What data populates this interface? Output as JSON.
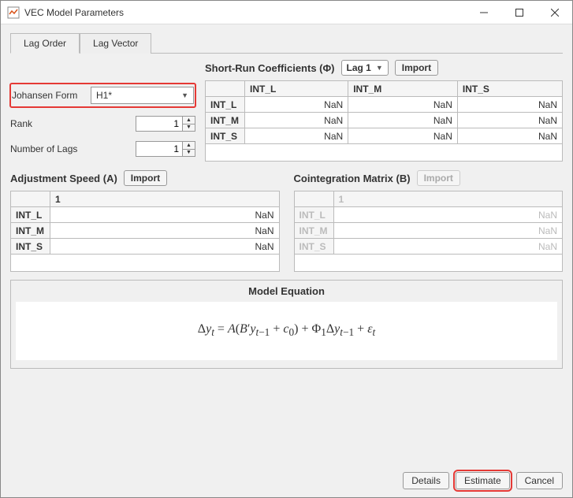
{
  "window": {
    "title": "VEC Model Parameters"
  },
  "tabs": {
    "lag_order": "Lag Order",
    "lag_vector": "Lag Vector"
  },
  "params": {
    "johansen_label": "Johansen Form",
    "johansen_value": "H1*",
    "rank_label": "Rank",
    "rank_value": "1",
    "numlags_label": "Number of Lags",
    "numlags_value": "1"
  },
  "short_run": {
    "title": "Short-Run Coefficients (Φ)",
    "lag_dropdown": "Lag 1",
    "import_label": "Import",
    "cols": [
      "INT_L",
      "INT_M",
      "INT_S"
    ],
    "rows": [
      {
        "name": "INT_L",
        "vals": [
          "NaN",
          "NaN",
          "NaN"
        ]
      },
      {
        "name": "INT_M",
        "vals": [
          "NaN",
          "NaN",
          "NaN"
        ]
      },
      {
        "name": "INT_S",
        "vals": [
          "NaN",
          "NaN",
          "NaN"
        ]
      }
    ]
  },
  "adj_speed": {
    "title": "Adjustment Speed (A)",
    "import_label": "Import",
    "col": "1",
    "rows": [
      {
        "name": "INT_L",
        "val": "NaN"
      },
      {
        "name": "INT_M",
        "val": "NaN"
      },
      {
        "name": "INT_S",
        "val": "NaN"
      }
    ]
  },
  "coint_matrix": {
    "title": "Cointegration Matrix (B)",
    "import_label": "Import",
    "col": "1",
    "rows": [
      {
        "name": "INT_L",
        "val": "NaN"
      },
      {
        "name": "INT_M",
        "val": "NaN"
      },
      {
        "name": "INT_S",
        "val": "NaN"
      }
    ]
  },
  "equation": {
    "title": "Model Equation"
  },
  "footer": {
    "details": "Details",
    "estimate": "Estimate",
    "cancel": "Cancel"
  }
}
